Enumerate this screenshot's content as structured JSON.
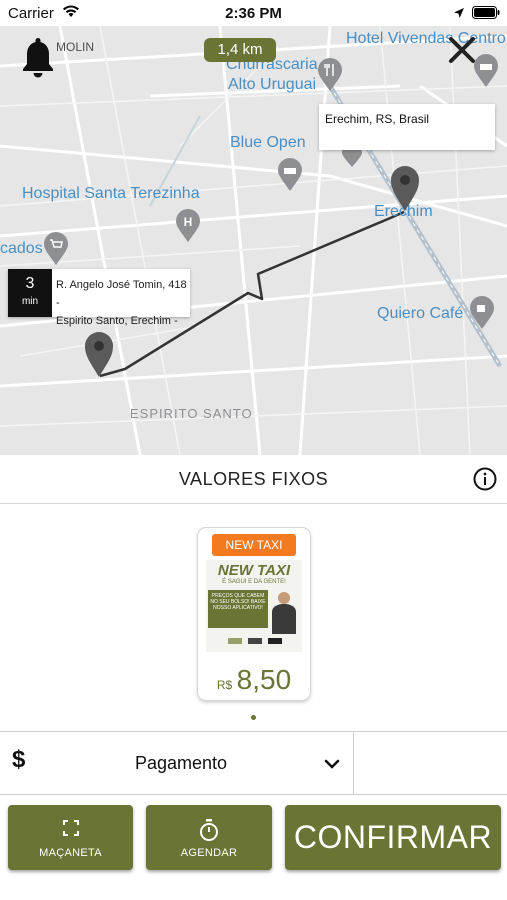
{
  "status_bar": {
    "carrier": "Carrier",
    "time": "2:36 PM"
  },
  "map": {
    "distance": "1,4 km",
    "pois": {
      "hotel": "Hotel Vivendas Centro",
      "churrascaria": "Churrascaria",
      "alto_uruguai": "Alto Uruguai",
      "blue_open": "Blue Open",
      "hospital": "Hospital Santa Terezinha",
      "erechim": "Erechim",
      "mercados": "cados",
      "quiero_cafe": "Quiero Café",
      "espirito_santo": "ESPIRITO SANTO",
      "molin": "MOLIN"
    },
    "destination": {
      "address": "Erechim, RS, Brasil"
    },
    "origin": {
      "eta_value": "3",
      "eta_unit": "min",
      "address_line1": "R. Angelo José Tomin, 418 -",
      "address_line2": "Espirito Santo, Erechim -"
    }
  },
  "section": {
    "title": "VALORES FIXOS"
  },
  "tariff": {
    "tag": "NEW TAXI",
    "promo_title": "NEW TAXI",
    "promo_subtitle": "É SAGUI E DA GENTE!",
    "promo_banner": "PREÇOS QUE CABEM NO SEU BOLSO! BAIXE NOSSO APLICATIVO!",
    "currency": "R$",
    "price": "8,50"
  },
  "payment": {
    "icon": "$",
    "label": "Pagamento"
  },
  "buttons": {
    "macaneta": "MAÇANETA",
    "agendar": "AGENDAR",
    "confirmar": "CONFIRMAR"
  },
  "colors": {
    "accent": "#6a7434",
    "tag": "#f47a20",
    "map_bg": "#e5e6e5",
    "poi_blue": "#4a8fc4"
  }
}
